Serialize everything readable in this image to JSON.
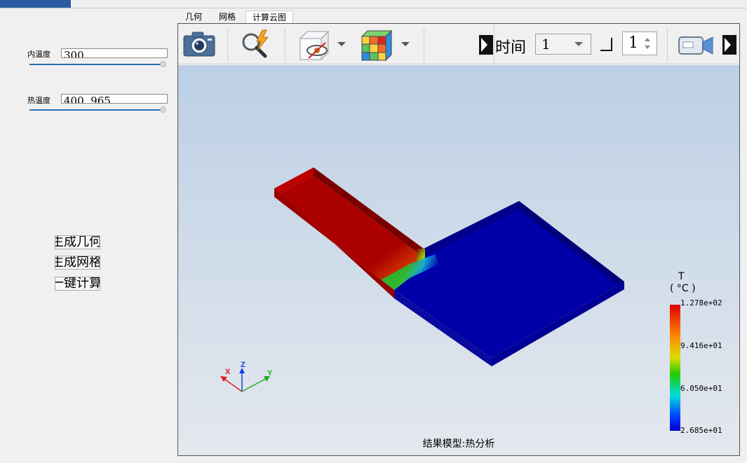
{
  "params": {
    "inner_temp": {
      "label": "内温度",
      "value": "300"
    },
    "hot_temp": {
      "label": "热温度",
      "value": "400, 965"
    }
  },
  "side_buttons": [
    {
      "label": "生成几何"
    },
    {
      "label": "生成网格"
    },
    {
      "label": "一键计算"
    }
  ],
  "tabs": [
    {
      "label": "几何",
      "active": false
    },
    {
      "label": "网格",
      "active": false
    },
    {
      "label": "计算云图",
      "active": true
    }
  ],
  "toolbar": {
    "screenshot_icon": "camera-icon",
    "quick_view_icon": "magnifier-lightning-icon",
    "display_mode_icon": "box-eye-icon",
    "colormap_icon": "color-cube-icon",
    "time_label": "时间",
    "time_value": "1",
    "step_value": "1",
    "record_icon": "video-camera-icon"
  },
  "viewport": {
    "caption": "结果模型:热分析",
    "axes": {
      "x": "X",
      "y": "Y",
      "z": "Z"
    },
    "colorbar": {
      "title_var": "T",
      "title_unit": "( °C )",
      "ticks": [
        "1.278e+02",
        "9.416e+01",
        "6.050e+01",
        "2.685e+01"
      ]
    }
  },
  "colors": {
    "hot": "#aa0000",
    "cold": "#0000a8",
    "accent": "#2a6fb0"
  }
}
